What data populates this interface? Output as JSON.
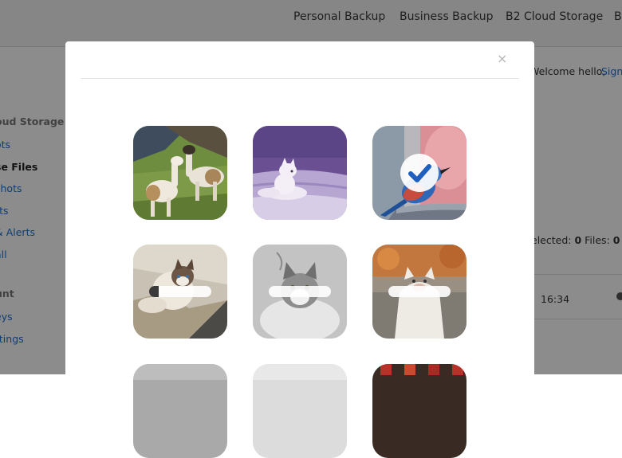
{
  "topnav": {
    "items": [
      "Personal Backup",
      "Business Backup",
      "B2 Cloud Storage",
      "B"
    ]
  },
  "sidebar": {
    "sections": [
      "oud Storage",
      "unt"
    ],
    "links": [
      "ots",
      "se Files",
      "shots",
      "rts",
      "& Alerts",
      "all",
      "eys",
      "ttings"
    ]
  },
  "rightpane": {
    "welcome": "Welcome hello,",
    "signout": "Sign",
    "selected_label": "elected:",
    "selected_count": "0",
    "files_label": "Files:",
    "files_count": "0",
    "bytes_fragment": "b",
    "time": "16:34"
  },
  "modal": {
    "close_label": "×",
    "tiles": [
      {
        "subject": "alpacas",
        "selected": false,
        "loading": false
      },
      {
        "subject": "arctic-fox",
        "selected": false,
        "loading": false
      },
      {
        "subject": "blue-bird",
        "selected": true,
        "loading": false
      },
      {
        "subject": "ragdoll-cat",
        "selected": false,
        "loading": true,
        "progress": 0.15
      },
      {
        "subject": "tabby-cat",
        "selected": false,
        "loading": true,
        "progress": 0.0
      },
      {
        "subject": "ghost-cat",
        "selected": false,
        "loading": true,
        "progress": 0.0
      },
      {
        "subject": "partial-gray",
        "selected": false,
        "loading": false
      },
      {
        "subject": "partial-light",
        "selected": false,
        "loading": false
      },
      {
        "subject": "partial-dark",
        "selected": false,
        "loading": false
      }
    ]
  },
  "colors": {
    "link": "#1f6fd1",
    "check_blue": "#1f5fbf",
    "overlay": "rgba(0,0,0,0.45)"
  }
}
